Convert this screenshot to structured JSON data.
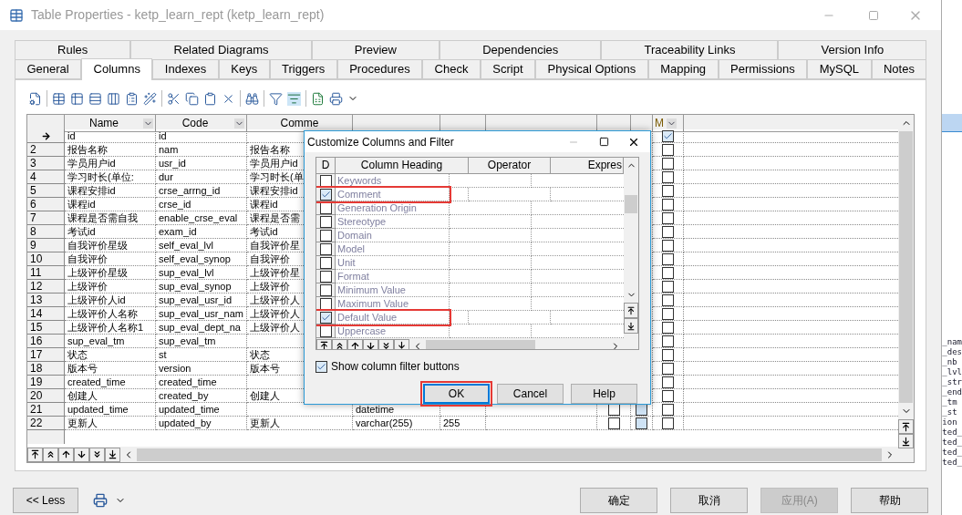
{
  "window": {
    "title": "Table Properties - ketp_learn_rept (ketp_learn_rept)"
  },
  "tabs_back": [
    {
      "label": "Rules"
    },
    {
      "label": "Related Diagrams"
    },
    {
      "label": "Preview"
    },
    {
      "label": "Dependencies"
    },
    {
      "label": "Traceability Links"
    },
    {
      "label": "Version Info"
    }
  ],
  "tabs": [
    {
      "label": "General",
      "selected": false
    },
    {
      "label": "Columns",
      "selected": true
    },
    {
      "label": "Indexes",
      "selected": false
    },
    {
      "label": "Keys",
      "selected": false
    },
    {
      "label": "Triggers",
      "selected": false
    },
    {
      "label": "Procedures",
      "selected": false
    },
    {
      "label": "Check",
      "selected": false
    },
    {
      "label": "Script",
      "selected": false
    },
    {
      "label": "Physical Options",
      "selected": false
    },
    {
      "label": "Mapping",
      "selected": false
    },
    {
      "label": "Permissions",
      "selected": false
    },
    {
      "label": "MySQL",
      "selected": false
    },
    {
      "label": "Notes",
      "selected": false
    }
  ],
  "table": {
    "columns": [
      "Name",
      "Code",
      "Comme"
    ],
    "last_column": "M",
    "rows": [
      {
        "current": true,
        "name": "id",
        "code": "id",
        "m": true
      },
      {
        "number": "2",
        "name": "报告名称",
        "code": "nam",
        "comment": "报告名称",
        "m": false
      },
      {
        "number": "3",
        "name": "学员用户id",
        "code": "usr_id",
        "comment": "学员用户id",
        "m": false
      },
      {
        "number": "4",
        "name": "学习时长(单位:",
        "code": "dur",
        "comment": "学习时长(单",
        "m": false
      },
      {
        "number": "5",
        "name": "课程安排id",
        "code": "crse_arrng_id",
        "comment": "课程安排id",
        "m": false
      },
      {
        "number": "6",
        "name": "课程id",
        "code": "crse_id",
        "comment": "课程id",
        "m": false
      },
      {
        "number": "7",
        "name": "课程是否需自我",
        "code": "enable_crse_eval",
        "comment": "课程是否需",
        "m": false
      },
      {
        "number": "8",
        "name": "考试id",
        "code": "exam_id",
        "comment": "考试id",
        "m": false
      },
      {
        "number": "9",
        "name": "自我评价星级",
        "code": "self_eval_lvl",
        "comment": "自我评价星",
        "m": false
      },
      {
        "number": "10",
        "name": "自我评价",
        "code": "self_eval_synop",
        "comment": "自我评价",
        "m": false
      },
      {
        "number": "11",
        "name": "上级评价星级",
        "code": "sup_eval_lvl",
        "comment": "上级评价星",
        "m": false
      },
      {
        "number": "12",
        "name": "上级评价",
        "code": "sup_eval_synop",
        "comment": "上级评价",
        "m": false
      },
      {
        "number": "13",
        "name": "上级评价人id",
        "code": "sup_eval_usr_id",
        "comment": "上级评价人",
        "m": false
      },
      {
        "number": "14",
        "name": "上级评价人名称",
        "code": "sup_eval_usr_nam",
        "comment": "上级评价人",
        "m": false
      },
      {
        "number": "15",
        "name": "上级评价人名称1",
        "code": "sup_eval_dept_na",
        "comment": "上级评价人",
        "m": false
      },
      {
        "number": "16",
        "name": "sup_eval_tm",
        "code": "sup_eval_tm",
        "m": false
      },
      {
        "number": "17",
        "name": "状态",
        "code": "st",
        "comment": "状态",
        "m": false
      },
      {
        "number": "18",
        "name": "版本号",
        "code": "version",
        "comment": "版本号",
        "m": false
      },
      {
        "number": "19",
        "name": "created_time",
        "code": "created_time",
        "m": false
      },
      {
        "number": "20",
        "name": "创建人",
        "code": "created_by",
        "comment": "创建人",
        "m": false
      },
      {
        "number": "21",
        "name": "updated_time",
        "code": "updated_time",
        "data_type": "datetime",
        "p": false,
        "f": false,
        "f_highlighted": true,
        "m": false
      },
      {
        "number": "22",
        "name": "更新人",
        "code": "updated_by",
        "comment": "更新人",
        "data_type": "varchar(255)",
        "length": "255",
        "p": false,
        "f": false,
        "f_highlighted": true,
        "m": false
      }
    ]
  },
  "dialog": {
    "title": "Customize Columns and Filter",
    "columns": [
      "D",
      "Column Heading",
      "Operator",
      "Expres"
    ],
    "rows": [
      {
        "label": "Keywords",
        "checked": false,
        "marked": false
      },
      {
        "label": "Comment",
        "checked": true,
        "marked": true
      },
      {
        "label": "Generation Origin",
        "checked": false,
        "marked": false
      },
      {
        "label": "Stereotype",
        "checked": false,
        "marked": false
      },
      {
        "label": "Domain",
        "checked": false,
        "marked": false
      },
      {
        "label": "Model",
        "checked": false,
        "marked": false
      },
      {
        "label": "Unit",
        "checked": false,
        "marked": false
      },
      {
        "label": "Format",
        "checked": false,
        "marked": false
      },
      {
        "label": "Minimum Value",
        "checked": false,
        "marked": false
      },
      {
        "label": "Maximum Value",
        "checked": false,
        "marked": false
      },
      {
        "label": "Default Value",
        "checked": true,
        "marked": true
      },
      {
        "label": "Uppercase",
        "checked": false,
        "marked": false
      }
    ],
    "show_filter": {
      "label": "Show column filter buttons",
      "checked": true
    },
    "buttons": [
      {
        "label": "OK",
        "marked": true
      },
      {
        "label": "Cancel",
        "marked": false
      },
      {
        "label": "Help",
        "marked": false
      }
    ]
  },
  "less_button": "<< Less",
  "buttons": [
    {
      "label": "确定",
      "disabled": false
    },
    {
      "label": "取消",
      "disabled": false
    },
    {
      "label": "应用(A)",
      "disabled": true
    },
    {
      "label": "帮助",
      "disabled": false
    }
  ],
  "background_fragments": [
    "_nam",
    "_des",
    "_nb",
    "_lvl",
    "_str",
    "_end",
    "_tm",
    "_st",
    "ion",
    "ted_",
    "ted_",
    "ted_",
    "ted_"
  ]
}
